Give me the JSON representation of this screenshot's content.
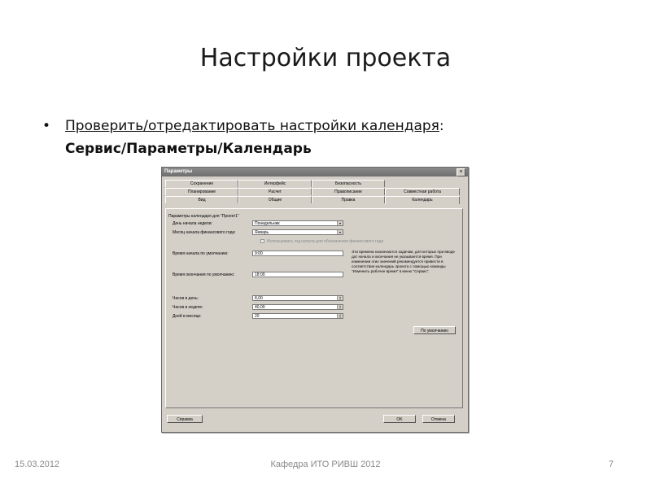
{
  "slide": {
    "title": "Настройки проекта",
    "bullet": {
      "dot": "•",
      "text_underlined": "Проверить/отредактировать настройки календаря",
      "colon": ":",
      "path": "Сервис/Параметры/Календарь"
    },
    "footer": {
      "date": "15.03.2012",
      "center": "Кафедра ИТО РИВШ 2012",
      "page": "7"
    }
  },
  "dialog": {
    "title": "Параметры",
    "close": "×",
    "tabs_row1": [
      "Сохранение",
      "Интерфейс",
      "Безопасность"
    ],
    "tabs_row2": [
      "Планирование",
      "Расчет",
      "Правописание",
      "Совместная работа"
    ],
    "tabs_row3": [
      "Вид",
      "Общие",
      "Правка",
      "Календарь"
    ],
    "group_title": "Параметры календаря для \"Проект1\"",
    "week_start_label": "День начала недели:",
    "week_start_value": "Понедельник",
    "fiscal_month_label": "Месяц начала финансового года:",
    "fiscal_month_value": "Январь",
    "fiscal_checkbox_label": "Использовать год начала для обозначения финансового года",
    "default_start_label": "Время начала по умолчанию:",
    "default_start_value": "9:00",
    "default_end_label": "Время окончания по умолчанию:",
    "default_end_value": "18:00",
    "note": "Эти времена назначаются задачам, для которых при вводе дат начала и окончания не указывается время. При изменении этих значений рекомендуется привести в соответствие календарь проекта с помощью команды \"Изменить рабочее время\" в меню \"Сервис\".",
    "hours_day_label": "Часов в день:",
    "hours_day_value": "8,00",
    "hours_week_label": "Часов в неделе:",
    "hours_week_value": "40,00",
    "days_month_label": "Дней в месяце:",
    "days_month_value": "20",
    "default_button": "По умолчанию",
    "help_button": "Справка",
    "ok_button": "OK",
    "cancel_button": "Отмена",
    "dropdown_arrow": "▾"
  }
}
